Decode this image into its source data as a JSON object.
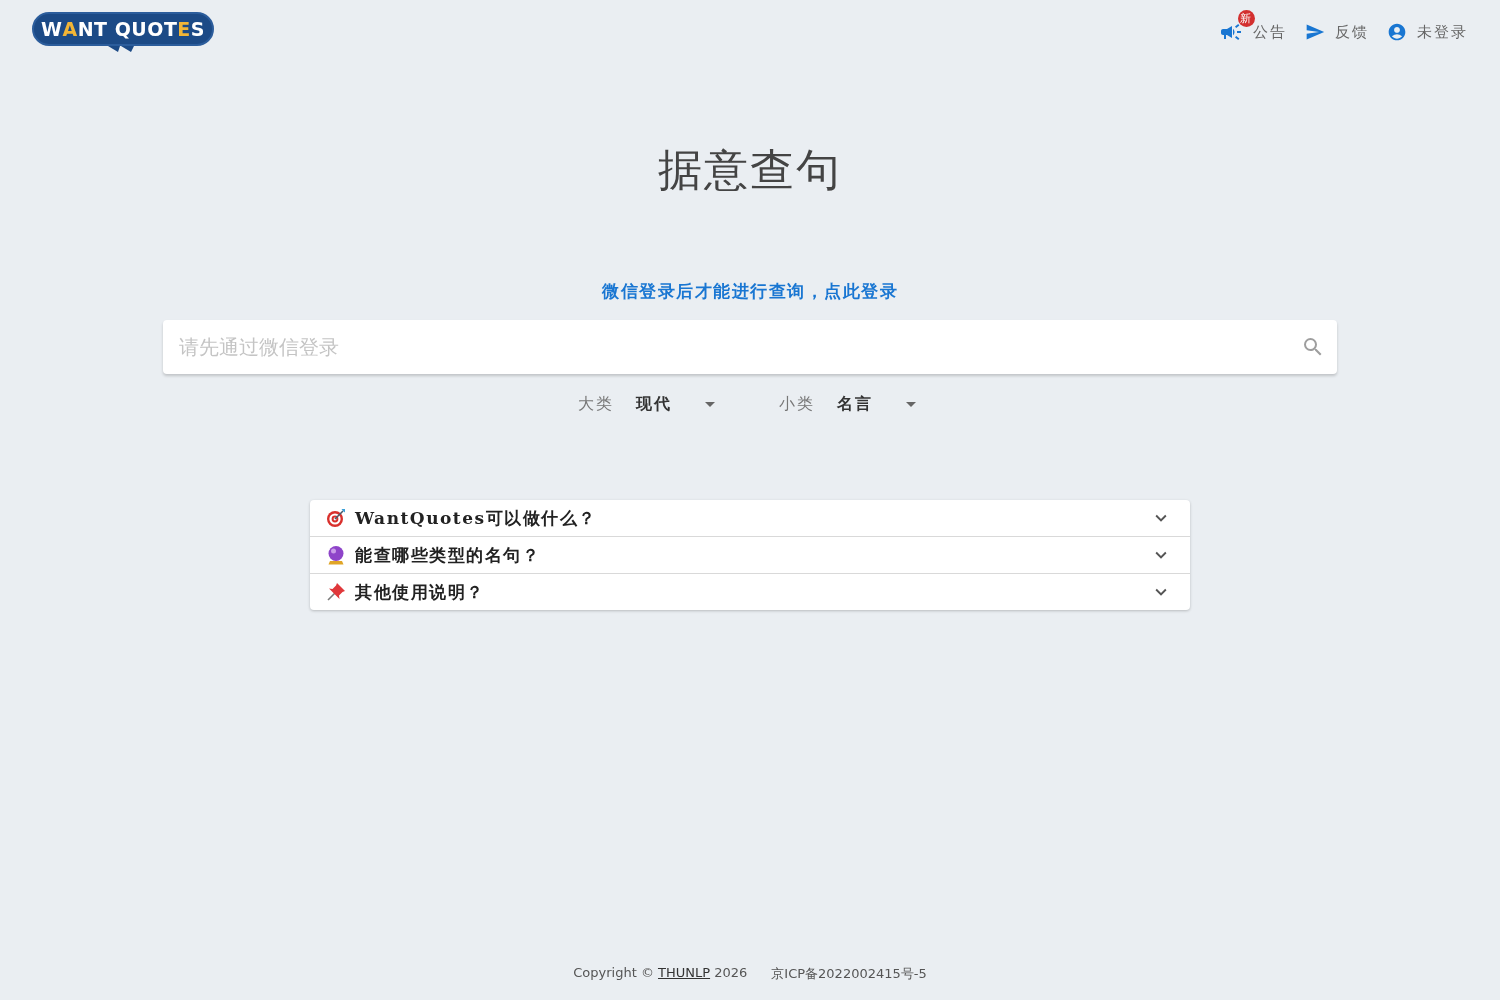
{
  "header": {
    "logo": [
      {
        "text": "W",
        "accent": false
      },
      {
        "text": "A",
        "accent": true
      },
      {
        "text": "NT QUOT",
        "accent": false
      },
      {
        "text": "E",
        "accent": true
      },
      {
        "text": "S",
        "accent": false
      }
    ],
    "announcements": {
      "label": "公告",
      "badge": "新"
    },
    "feedback": {
      "label": "反馈"
    },
    "account": {
      "label": "未登录"
    }
  },
  "title": "据意查句",
  "login_prompt": "微信登录后才能进行查询，点此登录",
  "search": {
    "placeholder": "请先通过微信登录"
  },
  "filters": [
    {
      "label": "大类",
      "value": "现代"
    },
    {
      "label": "小类",
      "value": "名言"
    }
  ],
  "faq": [
    {
      "title": "WantQuotes可以做什么？",
      "expanded": false
    },
    {
      "title": "能查哪些类型的名句？",
      "expanded": false
    },
    {
      "title": "其他使用说明？",
      "expanded": false
    }
  ],
  "footer": {
    "copyright_prefix": "Copyright ©",
    "copyright_link": "THUNLP",
    "copyright_year": "2026",
    "icp": "京ICP备2022002415号-5"
  }
}
